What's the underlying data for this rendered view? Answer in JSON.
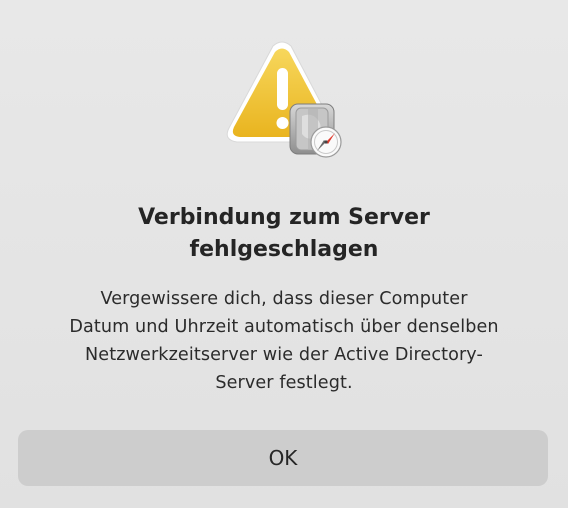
{
  "dialog": {
    "icon": "warning-icon",
    "badge_icon": "directory-utility-icon",
    "title_line1": "Verbindung zum Server",
    "title_line2": "fehlgeschlagen",
    "message_lines": [
      "Vergewissere dich, dass dieser Computer",
      "Datum und Uhrzeit automatisch über denselben",
      "Netzwerkzeitserver wie der Active Directory-",
      "Server festlegt."
    ],
    "ok_label": "OK"
  },
  "colors": {
    "background": "#e3e3e3",
    "button": "#cdcdcd",
    "warning_yellow": "#f2c235"
  }
}
